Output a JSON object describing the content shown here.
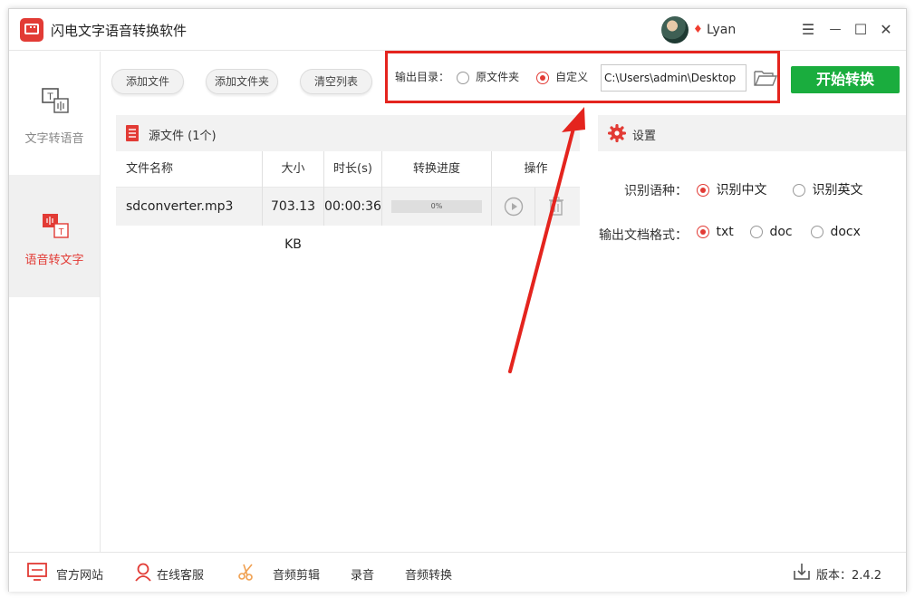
{
  "app": {
    "title": "闪电文字语音转换软件",
    "username": "Lyan"
  },
  "window_controls": {
    "menu": "☰",
    "minimize": "—",
    "maximize": "☐",
    "close": "✕"
  },
  "sidebar": {
    "items": [
      {
        "label": "文字转语音",
        "icon": "text-to-speech-icon",
        "active": false
      },
      {
        "label": "语音转文字",
        "icon": "speech-to-text-icon",
        "active": true
      }
    ]
  },
  "toolbar": {
    "add_file": "添加文件",
    "add_folder": "添加文件夹",
    "clear_list": "清空列表",
    "output_label": "输出目录：",
    "opt_original": "原文件夹",
    "opt_custom": "自定义",
    "output_path": "C:\\Users\\admin\\Desktop",
    "start": "开始转换"
  },
  "files": {
    "panel_title": "源文件 (1个)",
    "columns": [
      "文件名称",
      "大小",
      "时长(s)",
      "转换进度",
      "操作"
    ],
    "rows": [
      {
        "name": "sdconverter.mp3",
        "size": "703.13 KB",
        "duration": "00:00:36",
        "progress": "0%"
      }
    ]
  },
  "settings": {
    "title": "设置",
    "lang_label": "识别语种：",
    "lang_options": [
      "识别中文",
      "识别英文"
    ],
    "lang_selected": "识别中文",
    "format_label": "输出文档格式：",
    "format_options": [
      "txt",
      "doc",
      "docx"
    ],
    "format_selected": "txt"
  },
  "footer": {
    "website": "官方网站",
    "support": "在线客服",
    "audio_edit": "音频剪辑",
    "record": "录音",
    "audio_convert": "音频转换",
    "version": "版本：2.4.2"
  },
  "colors": {
    "accent": "#e23b35",
    "start": "#1aad3e",
    "annotation": "#e4241e"
  }
}
